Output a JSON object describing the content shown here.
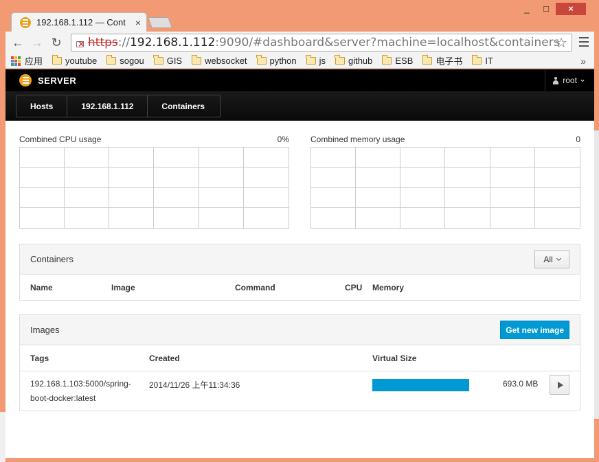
{
  "browser": {
    "tab_title": "192.168.1.112 — Cont",
    "tab_close": "×",
    "url_scheme": "https",
    "url_sep": "://",
    "url_host": "192.168.1.112",
    "url_rest": ":9090/#dashboard&server?machine=localhost&containers",
    "star": "☆",
    "back": "←",
    "forward": "→",
    "reload": "↻",
    "win_min": "_",
    "win_max": "□",
    "win_close": "×"
  },
  "bookmarks": {
    "apps_label": "应用",
    "items": [
      "youtube",
      "sogou",
      "GIS",
      "websocket",
      "python",
      "js",
      "github",
      "ESB",
      "电子书",
      "IT"
    ],
    "more": "»",
    "apps_colors": [
      "#e84335",
      "#fbbc05",
      "#34a853",
      "#4285f4",
      "#e84335",
      "#fbbc05",
      "#34a853",
      "#4285f4",
      "#e84335"
    ]
  },
  "app": {
    "brand": "SERVER",
    "user": "root",
    "user_caret": "⌄",
    "breadcrumbs": [
      "Hosts",
      "192.168.1.112",
      "Containers"
    ],
    "accent": "#0099d3",
    "brand_color": "#f0a020"
  },
  "cpu": {
    "label": "Combined CPU usage",
    "value": "0%"
  },
  "memory": {
    "label": "Combined memory usage",
    "value": "0"
  },
  "containers": {
    "title": "Containers",
    "filter": "All",
    "columns": [
      "Name",
      "Image",
      "Command",
      "CPU",
      "Memory"
    ]
  },
  "images": {
    "title": "Images",
    "action": "Get new image",
    "columns": [
      "Tags",
      "Created",
      "Virtual Size"
    ],
    "rows": [
      {
        "tag_line1": "192.168.1.103:5000/spring-",
        "tag_line2": "boot-docker:latest",
        "created": "2014/11/26 上午11:34:36",
        "size": "693.0 MB",
        "size_fraction": 1.0
      }
    ]
  }
}
